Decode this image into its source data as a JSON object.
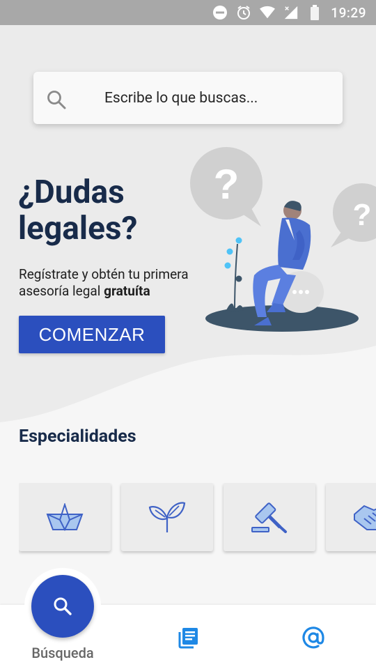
{
  "status_bar": {
    "time": "19:29",
    "icons": [
      "dnd-icon",
      "alarm-icon",
      "wifi-icon",
      "signal-icon",
      "battery-icon"
    ]
  },
  "search": {
    "placeholder": "Escribe lo que buscas...",
    "icon": "search-icon"
  },
  "hero": {
    "headline_line1": "¿Dudas",
    "headline_line2": "legales?",
    "subtitle_part1": "Regístrate y obtén tu primera asesoría legal",
    "subtitle_bold": "gratuíta",
    "cta_label": "COMENZAR"
  },
  "specialties": {
    "title": "Especialidades",
    "items": [
      {
        "icon": "paper-boat-icon"
      },
      {
        "icon": "sprout-icon"
      },
      {
        "icon": "gavel-icon"
      },
      {
        "icon": "handshake-icon"
      }
    ]
  },
  "bottom_nav": {
    "items": [
      {
        "label": "Búsqueda",
        "icon": "search-icon",
        "active": true
      },
      {
        "label": "",
        "icon": "news-icon",
        "active": false
      },
      {
        "label": "",
        "icon": "at-icon",
        "active": false
      }
    ]
  },
  "colors": {
    "primary": "#2b4fbe",
    "headline": "#182b4a",
    "accent_blue": "#1e88e5",
    "status_bar": "#a8a8a8",
    "hero_bg": "#ebebeb"
  }
}
